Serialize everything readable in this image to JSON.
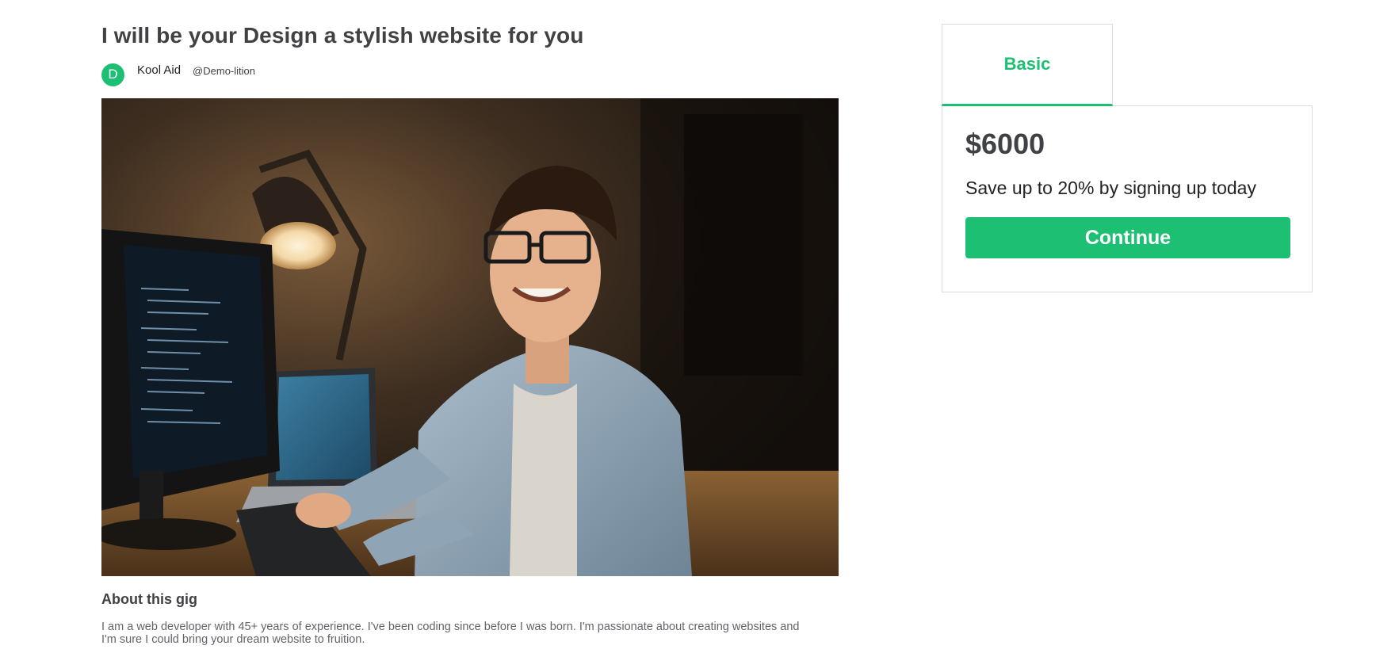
{
  "gig": {
    "title": "I will be your Design a stylish website for you",
    "seller": {
      "avatar_letter": "D",
      "name": "Kool Aid",
      "handle": "@Demo-lition"
    },
    "image_alt": "Smiling young developer in glasses and denim shirt at a desk with monitor showing code, laptop, and desk lamp",
    "about": {
      "heading": "About this gig",
      "text": "I am a web developer with 45+ years of experience. I've been coding since before I was born. I'm passionate about creating websites and I'm sure I could bring your dream website to fruition."
    }
  },
  "package": {
    "tabs": [
      {
        "label": "Basic",
        "active": true
      }
    ],
    "price": "$6000",
    "description": "Save up to 20% by signing up today",
    "cta_label": "Continue"
  },
  "colors": {
    "accent": "#1dbf73",
    "text_dark": "#404145",
    "border": "#dadbdd"
  }
}
